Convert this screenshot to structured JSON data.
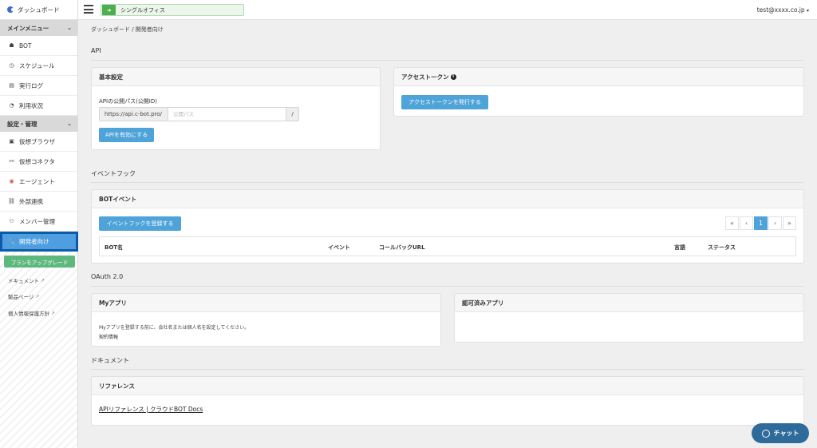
{
  "sidebar": {
    "dashboard": "ダッシュボード",
    "main_menu": "メインメニュー",
    "main_items": [
      {
        "label": "BOT",
        "icon": "robot-icon"
      },
      {
        "label": "スケジュール",
        "icon": "clock-icon"
      },
      {
        "label": "実行ログ",
        "icon": "file-icon"
      },
      {
        "label": "利用状況",
        "icon": "pie-chart-icon"
      }
    ],
    "settings_menu": "設定・管理",
    "settings_items": [
      {
        "label": "仮想ブラウザ",
        "icon": "browser-icon"
      },
      {
        "label": "仮想コネクタ",
        "icon": "connector-icon"
      },
      {
        "label": "エージェント",
        "icon": "agent-icon"
      },
      {
        "label": "外部連携",
        "icon": "link-icon"
      },
      {
        "label": "メンバー管理",
        "icon": "users-icon"
      }
    ],
    "active_item": "開発者向け",
    "upgrade": "プランをアップグレード",
    "links": [
      "ドキュメント",
      "製品ページ",
      "個人情報保護方針"
    ]
  },
  "topbar": {
    "office": "シングルオフィス",
    "user": "test@xxxx.co.jp"
  },
  "breadcrumb": "ダッシュボード  /  開発者向け",
  "api": {
    "title": "API",
    "basic": {
      "title": "基本設定",
      "label": "APIの公開パス(公開ID)",
      "prefix": "https://api.c-bot.pro/",
      "placeholder": "公開パス",
      "suffix": "/",
      "button": "APIを有効にする"
    },
    "token": {
      "title": "アクセストークン",
      "button": "アクセストークンを発行する"
    }
  },
  "hook": {
    "title": "イベントフック",
    "card_title": "BOTイベント",
    "button": "イベントフックを登録する",
    "pager": [
      "«",
      "‹",
      "1",
      "›",
      "»"
    ],
    "columns": [
      "BOT名",
      "イベント",
      "コールバックURL",
      "言語",
      "ステータス"
    ]
  },
  "oauth": {
    "title": "OAuth 2.0",
    "myapp_title": "Myアプリ",
    "myapp_note": "Myアプリを登録する前に、会社名または個人名を設定してください。",
    "myapp_link": "契約情報",
    "approved_title": "認可済みアプリ"
  },
  "docs": {
    "title": "ドキュメント",
    "card_title": "リファレンス",
    "link": "APIリファレンス | クラウドBOT Docs"
  },
  "chat": "チャット",
  "colors": {
    "accent": "#4ea3d9",
    "active_bg": "#0a5ca8",
    "upgrade": "#5db87e",
    "chat": "#2f6b9a"
  }
}
